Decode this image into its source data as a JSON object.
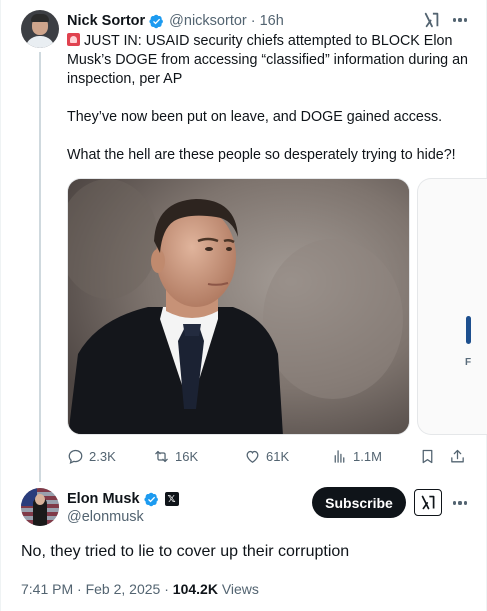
{
  "quoted_tweet": {
    "author_name": "Nick Sortor",
    "author_handle": "@nicksortor",
    "separator": "·",
    "time_ago": "16h",
    "emoji_icon": "rotating-light-emoji",
    "paragraphs": [
      "JUST IN: USAID security chiefs attempted to BLOCK Elon Musk’s DOGE from accessing “classified” information during an inspection, per AP",
      "They’ve now been put on leave, and DOGE gained access.",
      "What the hell are these people so desperately trying to hide?!"
    ],
    "next_media_letter": "F",
    "actions": {
      "replies": "2.3K",
      "reposts": "16K",
      "likes": "61K",
      "views": "1.1M"
    }
  },
  "reply_tweet": {
    "author_name": "Elon Musk",
    "author_handle": "@elonmusk",
    "affiliate_badge": "𝕏",
    "subscribe_label": "Subscribe",
    "text": "No, they tried to lie to cover up their corruption",
    "time": "7:41 PM",
    "separator": "·",
    "date": "Feb 2, 2025",
    "views_count": "104.2K",
    "views_label": "Views"
  },
  "colors": {
    "text_primary": "#0f1419",
    "text_muted": "#536471",
    "verified_blue": "#1d9bf0",
    "thread_line": "#cfd9de",
    "subscribe_bg": "#0f1419"
  }
}
